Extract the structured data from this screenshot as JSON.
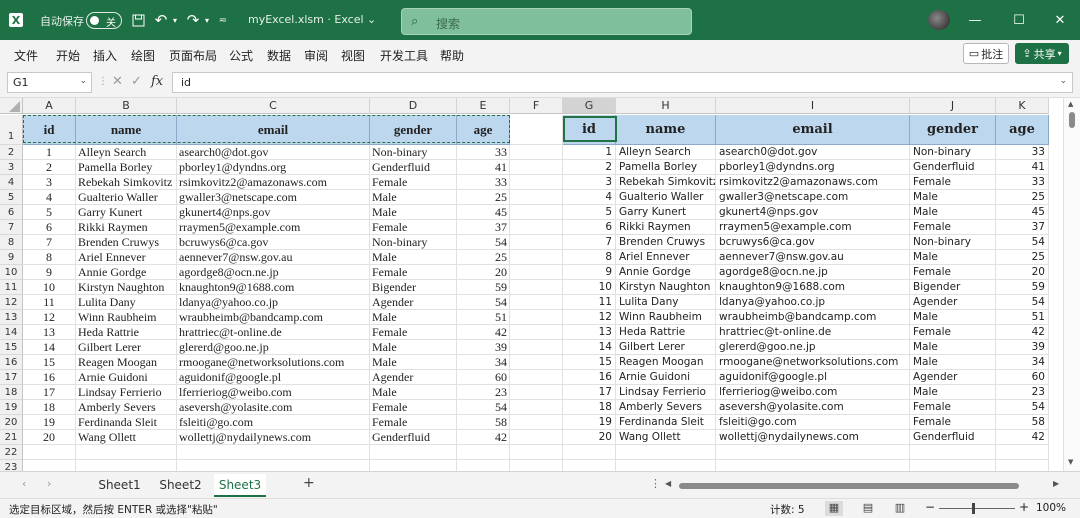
{
  "titlebar": {
    "autosave_label": "自动保存",
    "autosave_state": "关",
    "filename": "myExcel.xlsm",
    "app_sep": "·",
    "app_name": "Excel",
    "search_placeholder": "搜索"
  },
  "menus": [
    "文件",
    "开始",
    "插入",
    "绘图",
    "页面布局",
    "公式",
    "数据",
    "审阅",
    "视图",
    "开发工具",
    "帮助"
  ],
  "ribbon_buttons": {
    "comment": "批注",
    "share": "共享"
  },
  "formula_bar": {
    "name_box": "G1",
    "fx": "fx",
    "formula": "id"
  },
  "columns": [
    "A",
    "B",
    "C",
    "D",
    "E",
    "F",
    "G",
    "H",
    "I",
    "J",
    "K"
  ],
  "rows": [
    "1",
    "2",
    "3",
    "4",
    "5",
    "6",
    "7",
    "8",
    "9",
    "10",
    "11",
    "12",
    "13",
    "14",
    "15",
    "16",
    "17",
    "18",
    "19",
    "20",
    "21",
    "22",
    "23"
  ],
  "table_headers": [
    "id",
    "name",
    "email",
    "gender",
    "age"
  ],
  "records": [
    [
      "1",
      "Alleyn Search",
      "asearch0@dot.gov",
      "Non-binary",
      "33"
    ],
    [
      "2",
      "Pamella Borley",
      "pborley1@dyndns.org",
      "Genderfluid",
      "41"
    ],
    [
      "3",
      "Rebekah Simkovitz",
      "rsimkovitz2@amazonaws.com",
      "Female",
      "33"
    ],
    [
      "4",
      "Gualterio Waller",
      "gwaller3@netscape.com",
      "Male",
      "25"
    ],
    [
      "5",
      "Garry Kunert",
      "gkunert4@nps.gov",
      "Male",
      "45"
    ],
    [
      "6",
      "Rikki Raymen",
      "rraymen5@example.com",
      "Female",
      "37"
    ],
    [
      "7",
      "Brenden Cruwys",
      "bcruwys6@ca.gov",
      "Non-binary",
      "54"
    ],
    [
      "8",
      "Ariel Ennever",
      "aennever7@nsw.gov.au",
      "Male",
      "25"
    ],
    [
      "9",
      "Annie Gordge",
      "agordge8@ocn.ne.jp",
      "Female",
      "20"
    ],
    [
      "10",
      "Kirstyn Naughton",
      "knaughton9@1688.com",
      "Bigender",
      "59"
    ],
    [
      "11",
      "Lulita Dany",
      "ldanya@yahoo.co.jp",
      "Agender",
      "54"
    ],
    [
      "12",
      "Winn Raubheim",
      "wraubheimb@bandcamp.com",
      "Male",
      "51"
    ],
    [
      "13",
      "Heda Rattrie",
      "hrattriec@t-online.de",
      "Female",
      "42"
    ],
    [
      "14",
      "Gilbert Lerer",
      "glererd@goo.ne.jp",
      "Male",
      "39"
    ],
    [
      "15",
      "Reagen Moogan",
      "rmoogane@networksolutions.com",
      "Male",
      "34"
    ],
    [
      "16",
      "Arnie Guidoni",
      "aguidonif@google.pl",
      "Agender",
      "60"
    ],
    [
      "17",
      "Lindsay Ferrierio",
      "lferrieriog@weibo.com",
      "Male",
      "23"
    ],
    [
      "18",
      "Amberly Severs",
      "aseversh@yolasite.com",
      "Female",
      "54"
    ],
    [
      "19",
      "Ferdinanda Sleit",
      "fsleiti@go.com",
      "Female",
      "58"
    ],
    [
      "20",
      "Wang Ollett",
      "wollettj@nydailynews.com",
      "Genderfluid",
      "42"
    ]
  ],
  "sheets": [
    "Sheet1",
    "Sheet2",
    "Sheet3"
  ],
  "active_sheet": "Sheet3",
  "statusbar": {
    "message": "选定目标区域，然后按 ENTER 或选择\"粘贴\"",
    "count": "计数: 5",
    "zoom": "100%"
  }
}
